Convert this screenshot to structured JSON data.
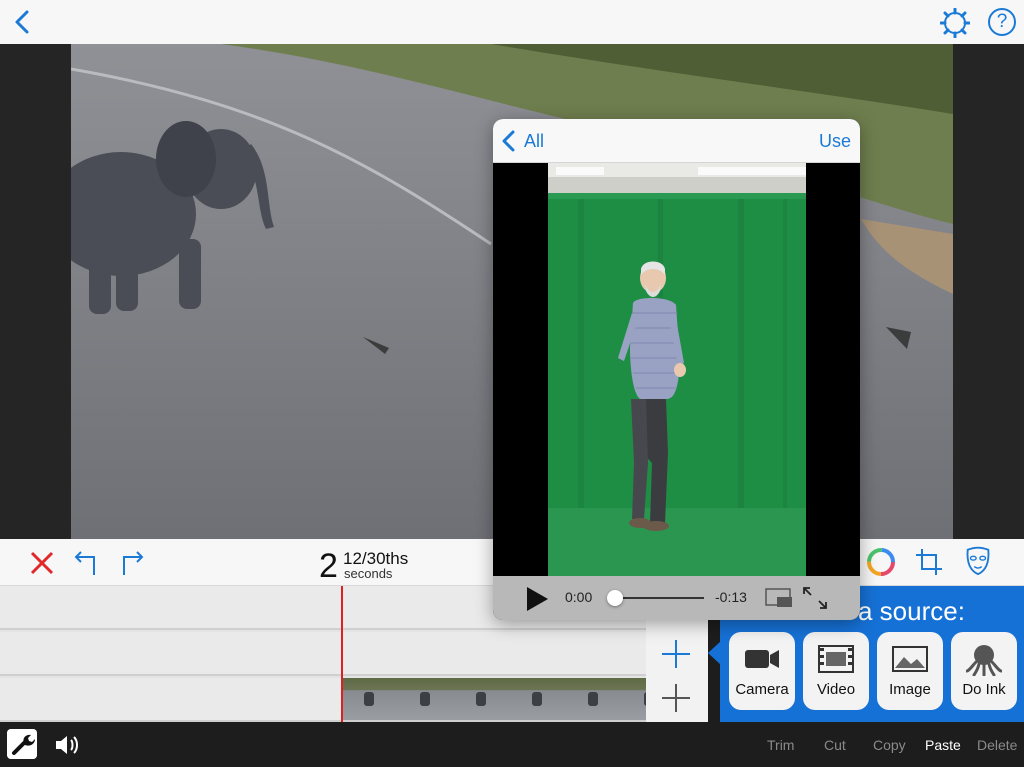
{
  "colors": {
    "accent": "#1a7ad6",
    "source_panel": "#1671d6",
    "playhead": "#e02020",
    "delete_x": "#e02828"
  },
  "topbar": {
    "back_icon": "chevron-left-icon",
    "settings_icon": "gear-icon",
    "help_label": "?"
  },
  "timeline": {
    "seconds": "2",
    "frames": "12/30ths",
    "unit": "seconds"
  },
  "toolbar_icons": [
    "close-icon",
    "undo-icon",
    "redo-icon",
    "color-wheel-icon",
    "crop-icon",
    "mask-icon"
  ],
  "picker": {
    "back_label": "All",
    "use_label": "Use",
    "time_elapsed": "0:00",
    "time_remaining": "-0:13",
    "progress": 0.0
  },
  "source": {
    "title": "a source:",
    "buttons": [
      {
        "label": "Camera",
        "icon": "camera-icon"
      },
      {
        "label": "Video",
        "icon": "film-icon"
      },
      {
        "label": "Image",
        "icon": "image-icon"
      },
      {
        "label": "Do Ink",
        "icon": "octopus-icon"
      }
    ]
  },
  "edit_menu": {
    "trim": "Trim",
    "cut": "Cut",
    "copy": "Copy",
    "paste": "Paste",
    "delete": "Delete"
  }
}
